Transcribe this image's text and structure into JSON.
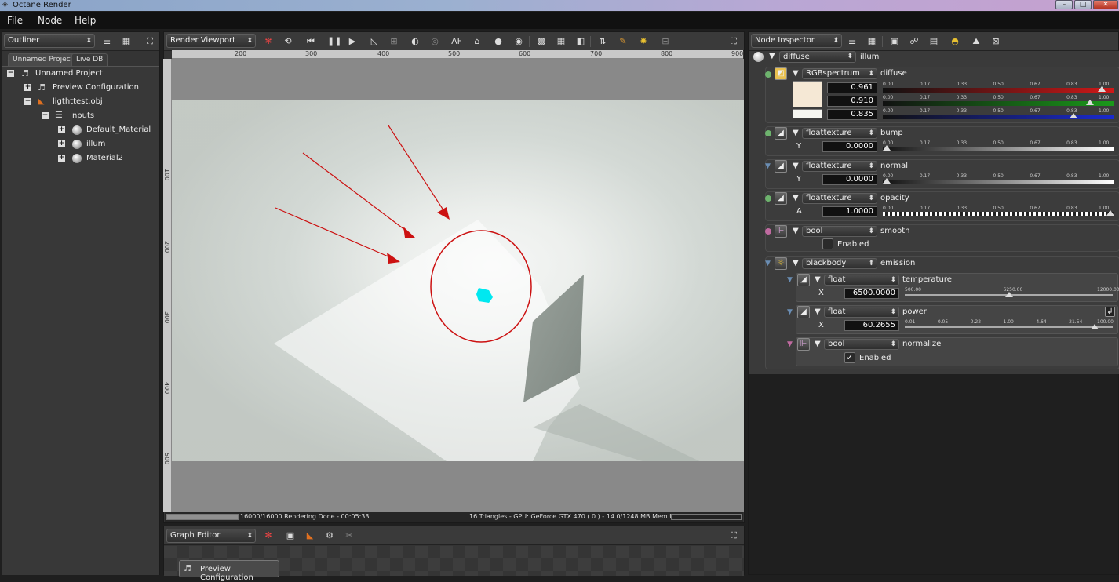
{
  "window": {
    "title": "Octane Render",
    "controls": [
      "–",
      "□",
      "✕"
    ]
  },
  "menu": [
    "File",
    "Node",
    "Help"
  ],
  "outliner": {
    "dropdown": "Outliner",
    "tabs": [
      "Unnamed Project",
      "Live DB"
    ],
    "tree": [
      {
        "label": "Unnamed Project"
      },
      {
        "label": "Preview Configuration"
      },
      {
        "label": "ligthttest.obj"
      },
      {
        "label": "Inputs"
      },
      {
        "label": "Default_Material"
      },
      {
        "label": "illum"
      },
      {
        "label": "Material2"
      }
    ]
  },
  "viewport": {
    "dropdown": "Render Viewport",
    "toolbar_text": {
      "af": "AF"
    },
    "ruler_top": [
      "200",
      "300",
      "400",
      "500",
      "600",
      "700",
      "800",
      "900"
    ],
    "ruler_left": [
      "100",
      "200",
      "300",
      "400",
      "500"
    ],
    "status_left": "16000/16000 Rendering Done - 00:05:33",
    "status_right": "16 Triangles - GPU: GeForce GTX 470 ( 0 ) - 14.0/1248 MB Mem Used",
    "progress": 1.0
  },
  "graph_editor": {
    "dropdown": "Graph Editor",
    "node_label": "Preview Configuration"
  },
  "inspector": {
    "dropdown": "Node Inspector",
    "root": {
      "type": "diffuse",
      "name": "illum"
    },
    "diffuse": {
      "type": "RGBspectrum",
      "name": "diffuse",
      "values": [
        "0.961",
        "0.910",
        "0.835"
      ],
      "scale": [
        "0.00",
        "0.17",
        "0.33",
        "0.50",
        "0.67",
        "0.83",
        "1.00"
      ],
      "positions": [
        0.961,
        0.91,
        0.835
      ],
      "color": "#f5e8d5"
    },
    "bump": {
      "type": "floattexture",
      "name": "bump",
      "axis": "Y",
      "value": "0.0000",
      "pos": 0.0
    },
    "normal": {
      "type": "floattexture",
      "name": "normal",
      "axis": "Y",
      "value": "0.0000",
      "pos": 0.0
    },
    "opacity": {
      "type": "floattexture",
      "name": "opacity",
      "axis": "A",
      "value": "1.0000",
      "pos": 1.0
    },
    "smooth": {
      "type": "bool",
      "name": "smooth",
      "check_label": "Enabled"
    },
    "emission": {
      "type": "blackbody",
      "name": "emission",
      "temperature": {
        "type": "float",
        "name": "temperature",
        "axis": "X",
        "value": "6500.0000",
        "scale": [
          "500.00",
          "6250.00",
          "12000.00"
        ],
        "pos": 0.5
      },
      "power": {
        "type": "float",
        "name": "power",
        "axis": "X",
        "value": "60.2655",
        "scale": [
          "0.01",
          "0.05",
          "0.22",
          "1.00",
          "4.64",
          "21.54",
          "100.00"
        ],
        "pos": 0.93
      },
      "normalize": {
        "type": "bool",
        "name": "normalize",
        "check_label": "Enabled",
        "checked": "✓"
      }
    }
  },
  "colors": {
    "accent_red": "#cc1111",
    "cyan_light": "#00e8f0",
    "panel": "#343434"
  }
}
